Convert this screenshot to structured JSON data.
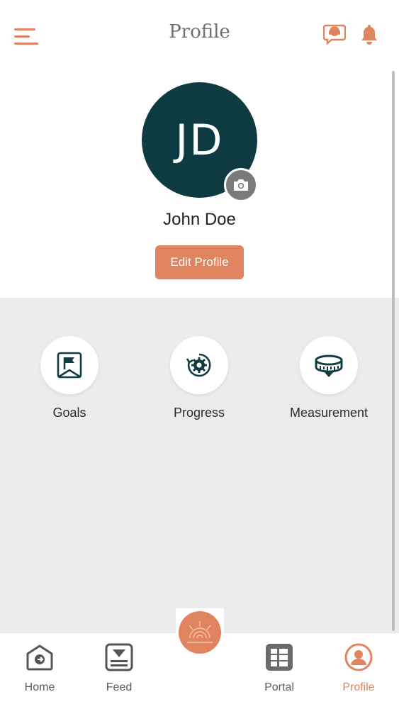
{
  "header": {
    "title": "Profile",
    "menu_icon": "hamburger-menu-icon",
    "chat_icon": "chat-support-icon",
    "notification_icon": "bell-icon"
  },
  "profile": {
    "initials": "JD",
    "name": "John Doe",
    "edit_label": "Edit Profile",
    "camera_icon": "camera-icon"
  },
  "features": [
    {
      "label": "Goals",
      "icon": "flag-icon"
    },
    {
      "label": "Progress",
      "icon": "progress-gear-icon"
    },
    {
      "label": "Measurement",
      "icon": "measuring-tape-icon"
    }
  ],
  "nav": {
    "items": [
      {
        "label": "Home",
        "icon": "home-icon"
      },
      {
        "label": "Feed",
        "icon": "feed-icon"
      },
      {
        "label": "Portal",
        "icon": "portal-grid-icon"
      },
      {
        "label": "Profile",
        "icon": "profile-icon",
        "active": true
      }
    ],
    "center_logo": "brand-logo"
  },
  "colors": {
    "accent": "#e0835f",
    "avatar_bg": "#0e3a42",
    "page_bg": "#ececee",
    "nav_inactive": "#5a5a5a"
  }
}
